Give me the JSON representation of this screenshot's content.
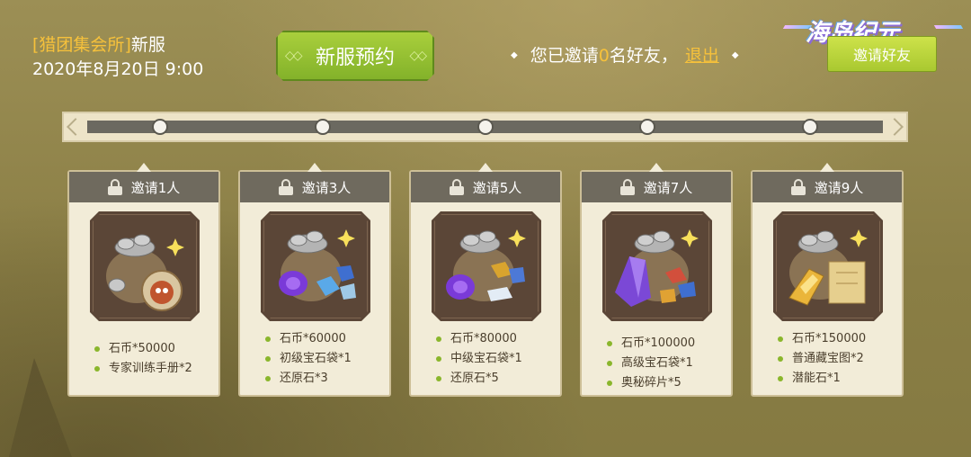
{
  "header": {
    "event_bracket_open": "[",
    "event_name": "猎团集会所",
    "event_bracket_close": "]",
    "event_suffix": "新服",
    "date": "2020年8月20日 9:00",
    "reserve_label": "新服预约",
    "reserve_deco_left": "◇◇",
    "reserve_deco_right": "◇◇"
  },
  "invite": {
    "prefix": "您已邀请",
    "count": "0",
    "suffix": "名好友，",
    "logout_label": "退出",
    "invite_button_label": "邀请好友",
    "diamond": "◆"
  },
  "logo": {
    "text": "海岛纪元"
  },
  "progress": {
    "invited": 0,
    "milestones": [
      1,
      3,
      5,
      7,
      9
    ],
    "fill_color": "#9ed13e"
  },
  "cards": [
    {
      "title": "邀请1人",
      "locked": true,
      "art": "coins-egg",
      "items": [
        "石币*50000",
        "专家训练手册*2"
      ]
    },
    {
      "title": "邀请3人",
      "locked": true,
      "art": "coins-gems",
      "items": [
        "石币*60000",
        "初级宝石袋*1",
        "还原石*3"
      ]
    },
    {
      "title": "邀请5人",
      "locked": true,
      "art": "coins-gems-crystal",
      "items": [
        "石币*80000",
        "中级宝石袋*1",
        "还原石*5"
      ]
    },
    {
      "title": "邀请7人",
      "locked": true,
      "art": "coins-crystal-large",
      "items": [
        "石币*100000",
        "高级宝石袋*1",
        "奥秘碎片*5"
      ]
    },
    {
      "title": "邀请9人",
      "locked": true,
      "art": "coins-map",
      "items": [
        "石币*150000",
        "普通藏宝图*2",
        "潜能石*1"
      ]
    }
  ],
  "colors": {
    "accent_yellow": "#f6c13b",
    "button_green": "#83b22a",
    "card_bg": "#f2ecd8",
    "card_head": "#6f6a5e"
  }
}
